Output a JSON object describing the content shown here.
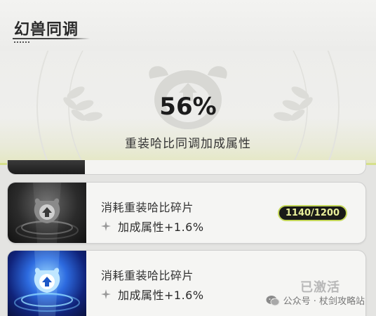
{
  "header": {
    "title": "幻兽同调"
  },
  "sync_panel": {
    "percent": "56%",
    "description": "重装哈比同调加成属性"
  },
  "cards": [
    {
      "title": "消耗重装哈比碎片",
      "effect": "加成属性+1.6%",
      "progress": "1140/1200",
      "progress_value": 0.95,
      "state": "locked"
    },
    {
      "title": "消耗重装哈比碎片",
      "effect": "加成属性+1.6%",
      "status": "已激活",
      "state": "activated"
    }
  ],
  "watermark": {
    "text": "公众号 · 杖剑攻略站",
    "icon": "wechat-icon"
  },
  "colors": {
    "accent": "#c5d85a",
    "badge_bg": "#1a1a18",
    "badge_text": "#e9ef9a",
    "active_thumb": "#2d6be0"
  }
}
